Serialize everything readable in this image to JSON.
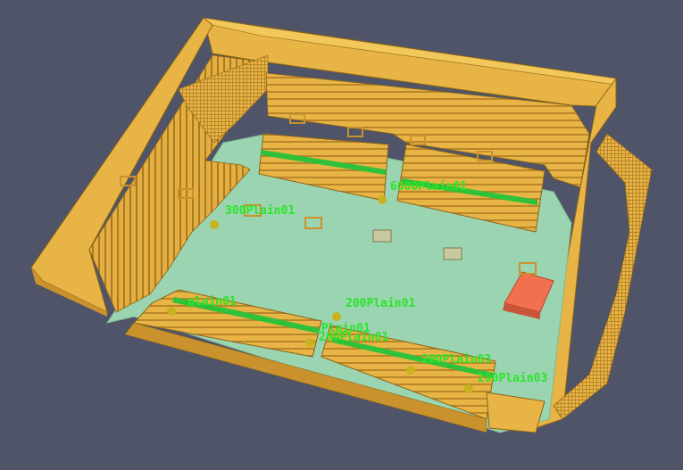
{
  "viewport": {
    "background": "#4f5468"
  },
  "colors": {
    "wall": "#e8b445",
    "wall_dark": "#c9922d",
    "wall_light": "#f2c85a",
    "wall_edge": "#8a6418",
    "floor": "#9bd4b0",
    "stage": "#f0704f",
    "label": "#29e62a",
    "marker": "#c9b220"
  },
  "labels": {
    "l1": "300Plain01",
    "l2": "6000Plain01",
    "l3": "200Plain01",
    "l4": "plain01",
    "l5": "200Plain01",
    "l6": "200Plain03",
    "l7": "200Plain03",
    "l8": "Plain01"
  }
}
